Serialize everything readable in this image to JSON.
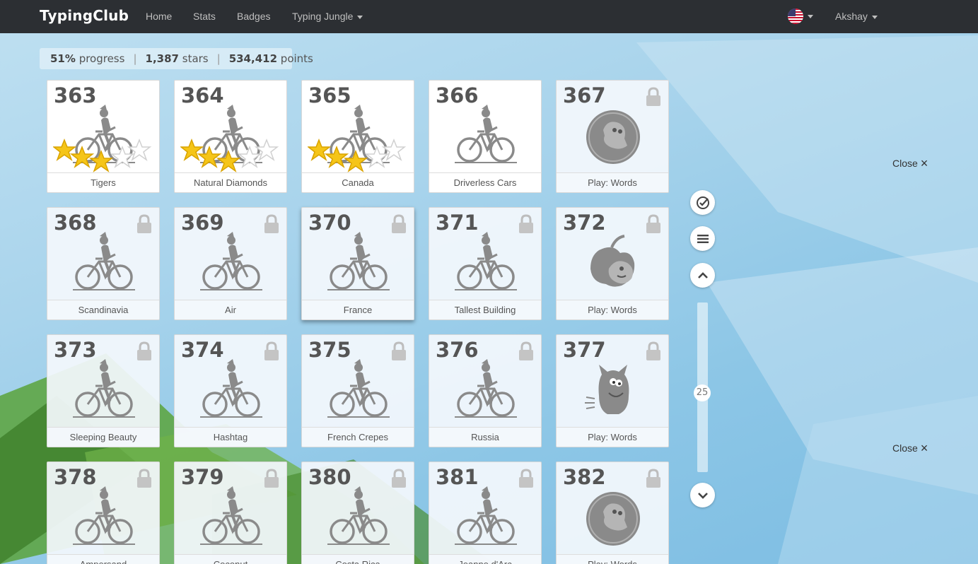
{
  "navbar": {
    "brand": "TypingClub",
    "links": [
      "Home",
      "Stats",
      "Badges"
    ],
    "jungle": "Typing Jungle",
    "user": "Akshay"
  },
  "progress": {
    "percent": "51%",
    "percent_label": "progress",
    "stars": "1,387",
    "stars_label": "stars",
    "points": "534,412",
    "points_label": "points",
    "separator": "|"
  },
  "lessons": [
    {
      "num": "363",
      "name": "Tigers",
      "locked": false,
      "stars": 3,
      "art": "cyclist-icon"
    },
    {
      "num": "364",
      "name": "Natural Diamonds",
      "locked": false,
      "stars": 3,
      "art": "cyclist-icon"
    },
    {
      "num": "365",
      "name": "Canada",
      "locked": false,
      "stars": 3,
      "art": "cyclist-icon"
    },
    {
      "num": "366",
      "name": "Driverless Cars",
      "locked": false,
      "stars": 0,
      "art": "cyclist-icon"
    },
    {
      "num": "367",
      "name": "Play: Words",
      "locked": true,
      "stars": 0,
      "art": "game-bubble-icon"
    },
    {
      "num": "368",
      "name": "Scandinavia",
      "locked": true,
      "stars": 0,
      "art": "cyclist-icon"
    },
    {
      "num": "369",
      "name": "Air",
      "locked": true,
      "stars": 0,
      "art": "cyclist-icon"
    },
    {
      "num": "370",
      "name": "France",
      "locked": true,
      "stars": 0,
      "art": "cyclist-icon"
    },
    {
      "num": "371",
      "name": "Tallest Building",
      "locked": true,
      "stars": 0,
      "art": "cyclist-icon"
    },
    {
      "num": "372",
      "name": "Play: Words",
      "locked": true,
      "stars": 0,
      "art": "game-apple-icon"
    },
    {
      "num": "373",
      "name": "Sleeping Beauty",
      "locked": true,
      "stars": 0,
      "art": "cyclist-icon"
    },
    {
      "num": "374",
      "name": "Hashtag",
      "locked": true,
      "stars": 0,
      "art": "cyclist-icon"
    },
    {
      "num": "375",
      "name": "French Crepes",
      "locked": true,
      "stars": 0,
      "art": "cyclist-icon"
    },
    {
      "num": "376",
      "name": "Russia",
      "locked": true,
      "stars": 0,
      "art": "cyclist-icon"
    },
    {
      "num": "377",
      "name": "Play: Words",
      "locked": true,
      "stars": 0,
      "art": "game-monster-icon"
    },
    {
      "num": "378",
      "name": "Ampersand",
      "locked": true,
      "stars": 0,
      "art": "cyclist-icon"
    },
    {
      "num": "379",
      "name": "Coconut",
      "locked": true,
      "stars": 0,
      "art": "cyclist-icon"
    },
    {
      "num": "380",
      "name": "Costa Rica",
      "locked": true,
      "stars": 0,
      "art": "cyclist-icon"
    },
    {
      "num": "381",
      "name": "Jeanne d'Arc",
      "locked": true,
      "stars": 0,
      "art": "cyclist-icon"
    },
    {
      "num": "382",
      "name": "Play: Words",
      "locked": true,
      "stars": 0,
      "art": "game-bubble-icon"
    }
  ],
  "side": {
    "close_label": "Close",
    "close_glyph": "×",
    "scroll_value": "25"
  },
  "colors": {
    "navbar": "#2c2f33",
    "star_gold": "#f5c518",
    "icon_gray": "#8a8a8a"
  }
}
